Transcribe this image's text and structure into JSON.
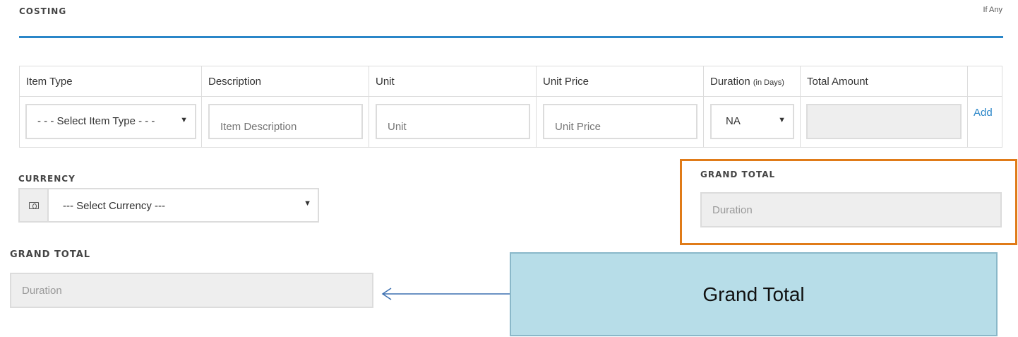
{
  "section": {
    "title": "COSTING",
    "note": "If Any"
  },
  "table": {
    "headers": {
      "item_type": "Item Type",
      "description": "Description",
      "unit": "Unit",
      "unit_price": "Unit Price",
      "duration": "Duration",
      "duration_suffix": "(in Days)",
      "total_amount": "Total Amount"
    },
    "row": {
      "item_type_selected": "- - - Select Item Type - - -",
      "description_placeholder": "Item Description",
      "unit_placeholder": "Unit",
      "unit_price_placeholder": "Unit Price",
      "duration_selected": "NA",
      "total_amount_value": "",
      "add_label": "Add"
    }
  },
  "currency": {
    "label": "CURRENCY",
    "icon": "money-icon",
    "selected": "--- Select Currency ---"
  },
  "grand_total_highlighted": {
    "label": "GRAND TOTAL",
    "placeholder": "Duration"
  },
  "grand_total_zoom": {
    "label": "GRAND TOTAL",
    "placeholder": "Duration"
  },
  "callout": {
    "text": "Grand Total"
  },
  "colors": {
    "accent": "#2a86c8",
    "highlight": "#e07b18",
    "callout_bg": "#b7dde8"
  }
}
